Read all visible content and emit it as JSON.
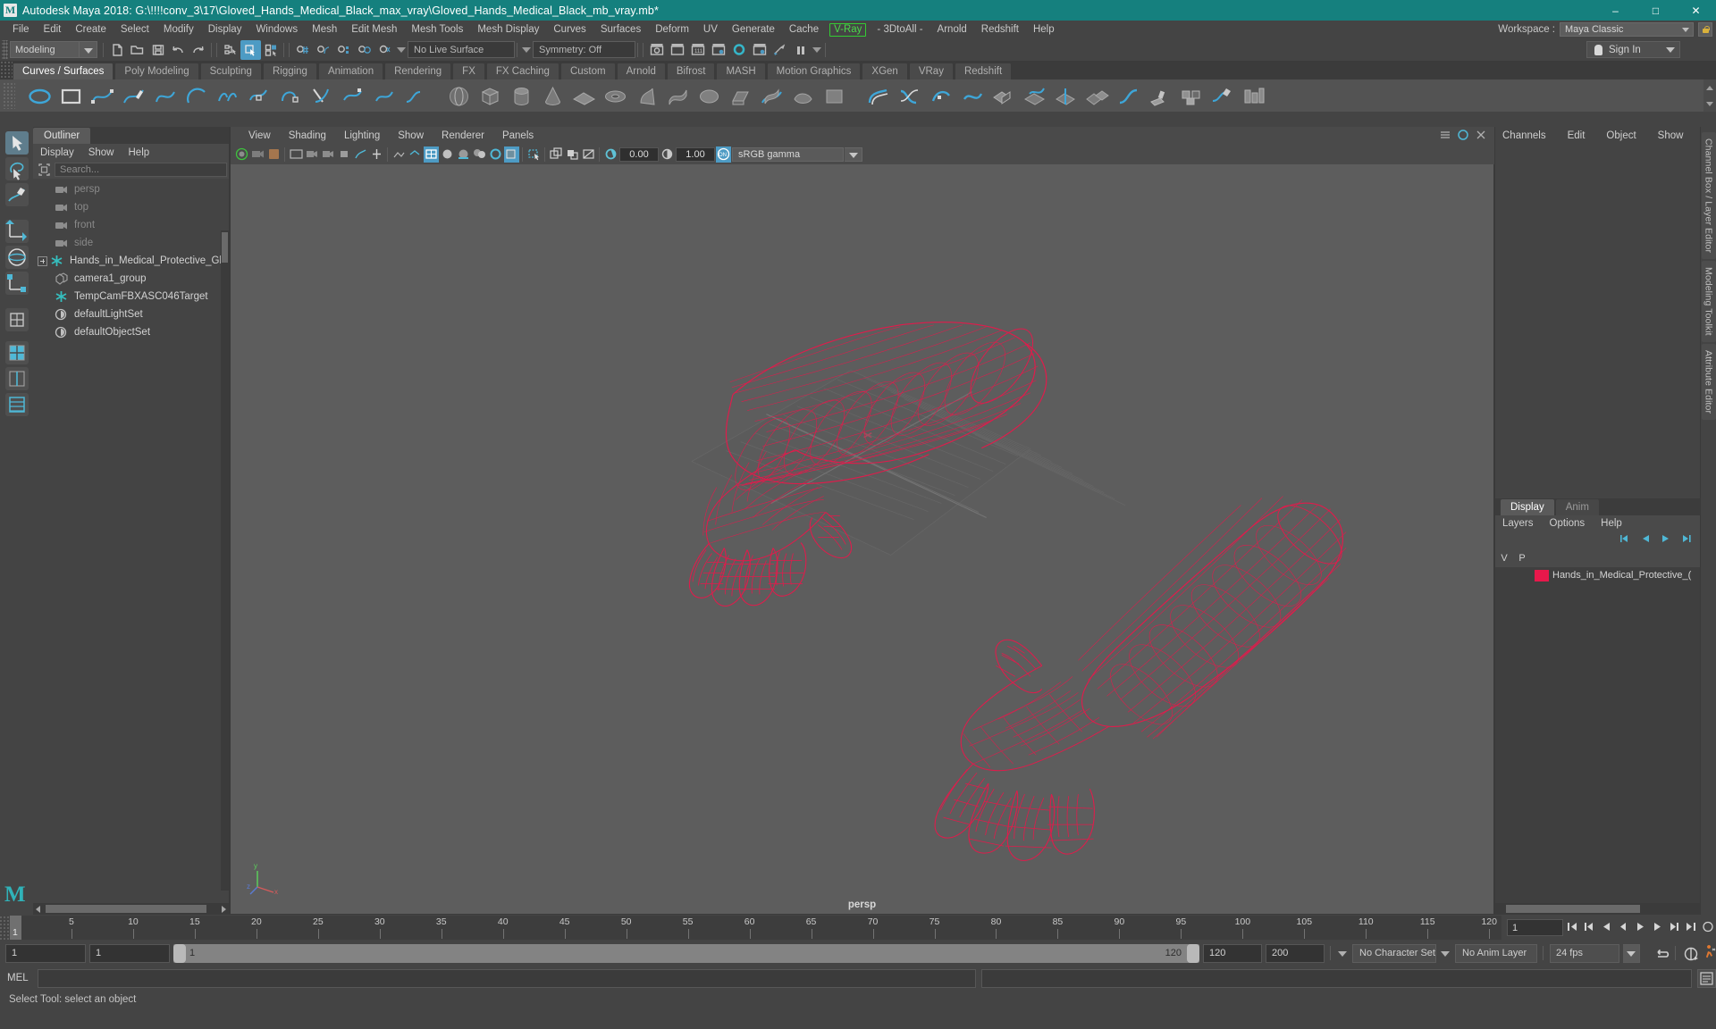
{
  "window": {
    "title": "Autodesk Maya 2018: G:\\!!!!conv_3\\17\\Gloved_Hands_Medical_Black_max_vray\\Gloved_Hands_Medical_Black_mb_vray.mb*",
    "app_icon": "maya-logo-icon",
    "minimize": "–",
    "maximize": "□",
    "close": "✕"
  },
  "menubar": {
    "items": [
      "File",
      "Edit",
      "Create",
      "Select",
      "Modify",
      "Display",
      "Windows",
      "Mesh",
      "Edit Mesh",
      "Mesh Tools",
      "Mesh Display",
      "Curves",
      "Surfaces",
      "Deform",
      "UV",
      "Generate",
      "Cache",
      "V-Ray",
      "- 3DtoAll -",
      "Arnold",
      "Redshift",
      "Help"
    ],
    "highlighted": "V-Ray",
    "highlight_color": "#33cc33",
    "workspace_label": "Workspace :",
    "workspace_value": "Maya Classic",
    "lock_icon": "lock-icon"
  },
  "toolbar": {
    "menu_set_value": "Modeling",
    "live_surface_value": "No Live Surface",
    "symmetry_value": "Symmetry: Off",
    "signin_label": "Sign In",
    "icons": [
      "new-scene-icon",
      "open-scene-icon",
      "save-scene-icon",
      "undo-icon",
      "redo-icon",
      "select-by-hierarchy-icon",
      "select-by-object-icon",
      "select-by-component-icon",
      "snap-to-grid-icon",
      "snap-to-curve-icon",
      "snap-to-point-icon",
      "snap-to-projected-center-icon",
      "snap-to-view-plane-icon",
      "render-current-frame-icon",
      "ipr-render-icon",
      "render-settings-icon",
      "hypershade-icon",
      "render-view-icon",
      "render-sequence-icon",
      "pause-icon"
    ]
  },
  "shelf": {
    "tabs": [
      "Curves / Surfaces",
      "Poly Modeling",
      "Sculpting",
      "Rigging",
      "Animation",
      "Rendering",
      "FX",
      "FX Caching",
      "Custom",
      "Arnold",
      "Bifrost",
      "MASH",
      "Motion Graphics",
      "XGen",
      "VRay",
      "Redshift"
    ],
    "active_tab": "Curves / Surfaces",
    "icon_names": [
      "nurbs-circle-icon",
      "nurbs-square-icon",
      "ep-curve-icon",
      "pencil-curve-icon",
      "bezier-curve-icon",
      "arc-3point-icon",
      "curve-attach-icon",
      "curve-detach-icon",
      "curve-open-close-icon",
      "curve-cv-hardness-icon",
      "curve-add-points-icon",
      "curve-offset-icon",
      "curve-fillet-icon",
      "curve-cut-icon",
      "sphere-icon",
      "cube-icon",
      "cylinder-icon",
      "cone-icon",
      "plane-icon",
      "torus-icon",
      "revolve-icon",
      "loft-icon",
      "planar-icon",
      "extrude-icon",
      "birail-icon",
      "boundary-icon",
      "square-surface-icon",
      "bevel-icon",
      "surface-intersect-icon",
      "surface-trim-icon",
      "surface-untrim-icon",
      "surface-booleans-icon",
      "surface-attach-icon",
      "surface-detach-icon",
      "align-surfaces-icon",
      "surface-fillet-icon",
      "sculpt-geometry-icon",
      "surface-editor-icon"
    ]
  },
  "toolbox": {
    "items": [
      "select-tool",
      "lasso-tool",
      "paint-select-tool",
      "move-tool",
      "rotate-tool",
      "scale-tool",
      "last-tool",
      "snap-align-object-tool",
      "layout-single-pane",
      "layout-two-pane",
      "layout-four-pane"
    ],
    "selected": "select-tool",
    "maya-logo": "maya-logo-icon"
  },
  "outliner": {
    "tab_title": "Outliner",
    "menus": [
      "Display",
      "Show",
      "Help"
    ],
    "search_placeholder": "Search...",
    "search_icon": "outliner-filter-icon",
    "items": [
      {
        "label": "persp",
        "icon": "camera-icon",
        "dim": true,
        "expandable": false
      },
      {
        "label": "top",
        "icon": "camera-icon",
        "dim": true,
        "expandable": false
      },
      {
        "label": "front",
        "icon": "camera-icon",
        "dim": true,
        "expandable": false
      },
      {
        "label": "side",
        "icon": "camera-icon",
        "dim": true,
        "expandable": false
      },
      {
        "label": "Hands_in_Medical_Protective_Gloves_",
        "icon": "transform-icon",
        "dim": false,
        "expandable": true
      },
      {
        "label": "camera1_group",
        "icon": "group-icon",
        "dim": false,
        "expandable": false
      },
      {
        "label": "TempCamFBXASC046Target",
        "icon": "transform-icon",
        "dim": false,
        "expandable": false
      },
      {
        "label": "defaultLightSet",
        "icon": "set-icon",
        "dim": false,
        "expandable": false
      },
      {
        "label": "defaultObjectSet",
        "icon": "set-icon",
        "dim": false,
        "expandable": false
      }
    ]
  },
  "viewport": {
    "menus": [
      "View",
      "Shading",
      "Lighting",
      "Show",
      "Renderer",
      "Panels"
    ],
    "camera_label": "persp",
    "exposure_value": "0.00",
    "gamma_value": "1.00",
    "color_management_value": "sRGB gamma",
    "color_management_toggle": "ON",
    "background_color": "#5d5d5d",
    "wireframe_color": "#e8184b",
    "grid_color": "#6b6b6b",
    "axis_labels": {
      "y": "y",
      "x": "x",
      "z": "z"
    },
    "icon_names": [
      "select-camera-icon",
      "camera-attributes-icon",
      "bookmarks-icon",
      "image-plane-icon",
      "2d-pan-zoom-icon",
      "grid-toggle-icon",
      "film-gate-icon",
      "resolution-gate-icon",
      "gate-mask-icon",
      "film-origin-icon",
      "xray-toggle-icon",
      "xray-joints-icon",
      "wireframe-on-shaded-icon",
      "smooth-shade-icon",
      "flat-shade-icon",
      "textured-toggle-icon",
      "lighting-toggle-icon",
      "shadows-toggle-icon",
      "screen-space-ao-icon",
      "motion-blur-icon",
      "multisample-icon",
      "depth-of-field-icon",
      "isolate-select-icon",
      "exposure-icon",
      "gamma-icon",
      "color-management-icon"
    ]
  },
  "channelbox": {
    "tabs": [
      "Channels",
      "Edit",
      "Object",
      "Show"
    ]
  },
  "layer_editor": {
    "tabs": [
      {
        "label": "Display",
        "active": true
      },
      {
        "label": "Anim",
        "active": false
      }
    ],
    "menus": [
      "Layers",
      "Options",
      "Help"
    ],
    "columns": [
      "V",
      "P"
    ],
    "layers": [
      {
        "visible": "",
        "playback": "",
        "color": "#e8184b",
        "name": "Hands_in_Medical_Protective_("
      }
    ],
    "tool_icons": [
      "layer-first-icon",
      "layer-prev-icon",
      "layer-next-icon",
      "layer-last-icon"
    ]
  },
  "right_vtabs": [
    "Channel Box / Layer Editor",
    "Modeling Toolkit",
    "Attribute Editor"
  ],
  "timeslider": {
    "current_frame": "1",
    "tick_labels": [
      "5",
      "10",
      "15",
      "20",
      "25",
      "30",
      "35",
      "40",
      "45",
      "50",
      "55",
      "60",
      "65",
      "70",
      "75",
      "80",
      "85",
      "90",
      "95",
      "100",
      "105",
      "110",
      "115",
      "120"
    ],
    "frame_field": "1",
    "playback_icons": [
      "go-to-start-icon",
      "step-back-key-icon",
      "step-back-frame-icon",
      "play-backwards-icon",
      "play-forwards-icon",
      "step-forward-frame-icon",
      "step-forward-key-icon",
      "go-to-end-icon"
    ]
  },
  "range": {
    "anim_start": "1",
    "range_start": "1",
    "slider_min_label": "1",
    "slider_max_label": "120",
    "range_end": "120",
    "anim_end": "200",
    "character_set": "No Character Set",
    "anim_layer": "No Anim Layer",
    "fps": "24 fps",
    "auto_key_icon": "auto-keyframe-icon",
    "anim_prefs_icon": "animation-preferences-icon",
    "cycle_icon": "playback-loop-icon"
  },
  "command_line": {
    "language_label": "MEL",
    "input_value": "",
    "output_value": "",
    "script_editor_icon": "script-editor-icon"
  },
  "status_bar": {
    "message": "Select Tool: select an object"
  },
  "colors": {
    "title_bar": "#15807e",
    "chrome": "#444444",
    "panel": "#4a4a4a",
    "accent_blue": "#4d9bc4",
    "wireframe_red": "#e8184b",
    "vray_green": "#33cc33"
  }
}
